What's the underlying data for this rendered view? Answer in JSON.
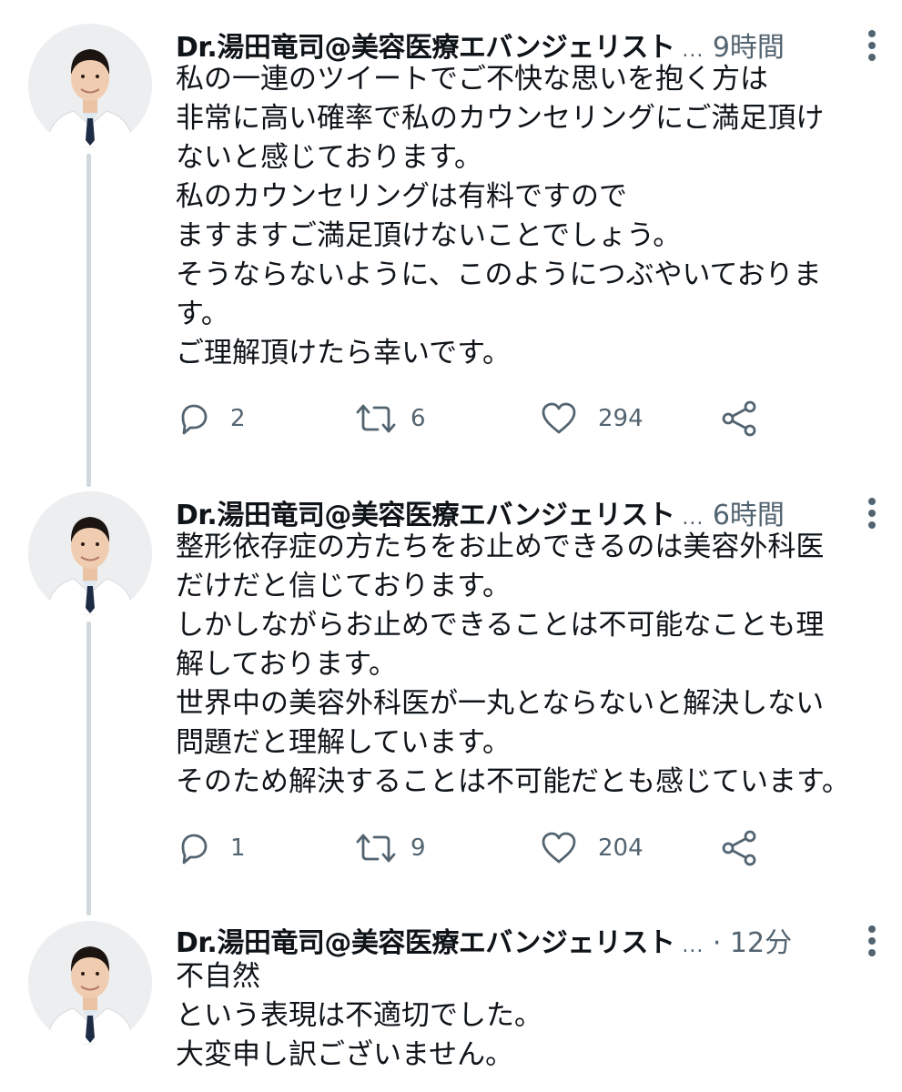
{
  "tweets": [
    {
      "name": "Dr.湯田竜司@美容医療エバンジェリスト",
      "meta": " 9時間",
      "body": "私の一連のツイートでご不快な思いを抱く方は\n非常に高い確率で私のカウンセリングにご満足頂け\nないと感じております。\n私のカウンセリングは有料ですので\nますますご満足頂けないことでしょう。\nそうならないように、このようにつぶやいておりま\nす。\nご理解頂けたら幸いです。",
      "replies": "2",
      "retweets": "6",
      "likes": "294"
    },
    {
      "name": "Dr.湯田竜司@美容医療エバンジェリスト",
      "meta": " 6時間",
      "body": "整形依存症の方たちをお止めできるのは美容外科医\nだけだと信じております。\nしかしながらお止めできることは不可能なことも理\n解しております。\n世界中の美容外科医が一丸とならないと解決しない\n問題だと理解しています。\nそのため解決することは不可能だとも感じています。",
      "replies": "1",
      "retweets": "9",
      "likes": "204"
    },
    {
      "name": "Dr.湯田竜司@美容医療エバンジェリスト",
      "meta": " · 12分",
      "body": "不自然\nという表現は不適切でした。\n大変申し訳ございません。"
    }
  ],
  "ellipsis": "...",
  "icons": {
    "reply": "reply-icon",
    "retweet": "retweet-icon",
    "like": "heart-icon",
    "share": "share-icon",
    "more": "more-vertical-icon"
  },
  "colors": {
    "text": "#0f1419",
    "secondary": "#536471",
    "thread_line": "#cfd9de"
  }
}
